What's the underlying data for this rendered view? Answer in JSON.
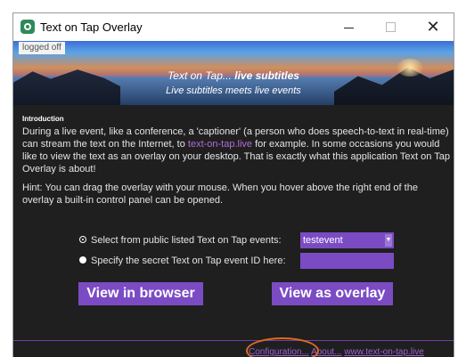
{
  "window": {
    "title": "Text on Tap Overlay",
    "close_glyph": "✕"
  },
  "status": {
    "login_text": "logged off"
  },
  "banner": {
    "title_lead": "Text on Tap... ",
    "title_strong": "live subtitles",
    "subtitle": "Live subtitles meets live events"
  },
  "intro": {
    "heading": "Introduction",
    "p1_before_link": "During a live event, like a conference, a 'captioner' (a person who does speech-to-text in real-time) can stream the text on the Internet, to ",
    "p1_link": "text-on-tap.live",
    "p1_after_link": " for example. In some occasions you would like to view the text as an overlay on your desktop. That is exactly what this application Text on Tap Overlay is about!",
    "hint": "Hint: You can drag the overlay with your mouse. When you hover above the right end of the overlay a built-in control panel can be opened."
  },
  "options": {
    "public_label": "Select from public listed Text on Tap events:",
    "public_selected": "testevent",
    "secret_label": "Specify the secret Text on Tap event ID here:",
    "secret_value": ""
  },
  "buttons": {
    "view_browser": "View in browser",
    "view_overlay": "View as overlay"
  },
  "footer": {
    "configuration": "Configuration...",
    "about": "About...",
    "website": "www.text-on-tap.live"
  },
  "colors": {
    "accent": "#7b4bc4",
    "link": "#b46bd9",
    "background": "#1f1f1f",
    "highlight_ring": "#e06a1f"
  }
}
